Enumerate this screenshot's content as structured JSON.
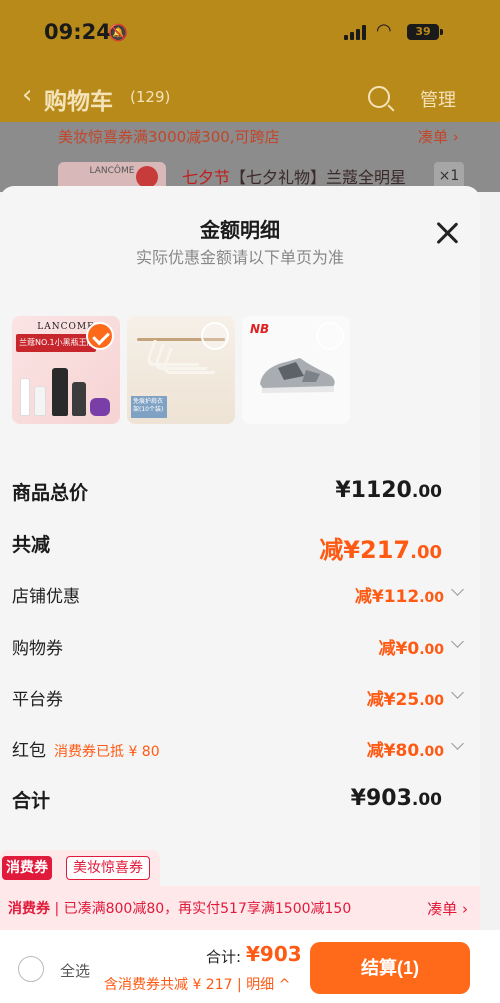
{
  "status_bar": {
    "time": "09:24",
    "battery": "39"
  },
  "header": {
    "title": "购物车",
    "count": "(129)",
    "manage": "管理"
  },
  "background_cart": {
    "promo": "美妆惊喜券满3000减300,可跨店",
    "promo_link": "凑单 ›",
    "item_title_red": "七夕节",
    "item_title": "【七夕礼物】兰蔻全明星",
    "item_qty": "×1"
  },
  "sheet": {
    "title": "金额明细",
    "subtitle": "实际优惠金额请以下单页为准",
    "products": [
      {
        "name": "lancome-set",
        "brand": "LANCOME",
        "banner": "兰蔻NO.1小黑瓶王牌",
        "selected": true
      },
      {
        "name": "hangers",
        "tag": "免痕护肩衣架(10个装)",
        "selected": false
      },
      {
        "name": "new-balance-shoe",
        "brand": "NB",
        "selected": false
      }
    ],
    "rows": {
      "goods_total": {
        "label": "商品总价",
        "value_main": "¥1120",
        "value_dec": ".00"
      },
      "total_discount": {
        "label": "共减",
        "value_main": "减¥217",
        "value_dec": ".00"
      },
      "shop_discount": {
        "label": "店铺优惠",
        "value_main": "减¥112",
        "value_dec": ".00"
      },
      "shopping_voucher": {
        "label": "购物券",
        "value_main": "减¥0",
        "value_dec": ".00"
      },
      "platform_voucher": {
        "label": "平台券",
        "value_main": "减¥25",
        "value_dec": ".00"
      },
      "red_packet": {
        "label": "红包",
        "note": "消费券已抵 ¥ 80",
        "value_main": "减¥80",
        "value_dec": ".00"
      },
      "sum": {
        "label": "合计",
        "value_main": "¥903",
        "value_dec": ".00"
      }
    },
    "tags": {
      "consumer_voucher": "消费券",
      "beauty_voucher": "美妆惊喜券"
    },
    "promo_bar": {
      "prefix": "消费券",
      "text": " | 已凑满800减80，再实付517享满1500减150",
      "link": "凑单 ›"
    }
  },
  "bottom_bar": {
    "select_all": "全选",
    "total_label": "合计:",
    "total_value": "¥903",
    "sub_prefix": "含消费券共减 ¥ 217 | ",
    "detail_link": "明细 ^",
    "pay_button": "结算(1)"
  },
  "colors": {
    "accent": "#ff5a14",
    "voucher_red": "#e01a3b",
    "header_bg": "#b88a1a"
  }
}
